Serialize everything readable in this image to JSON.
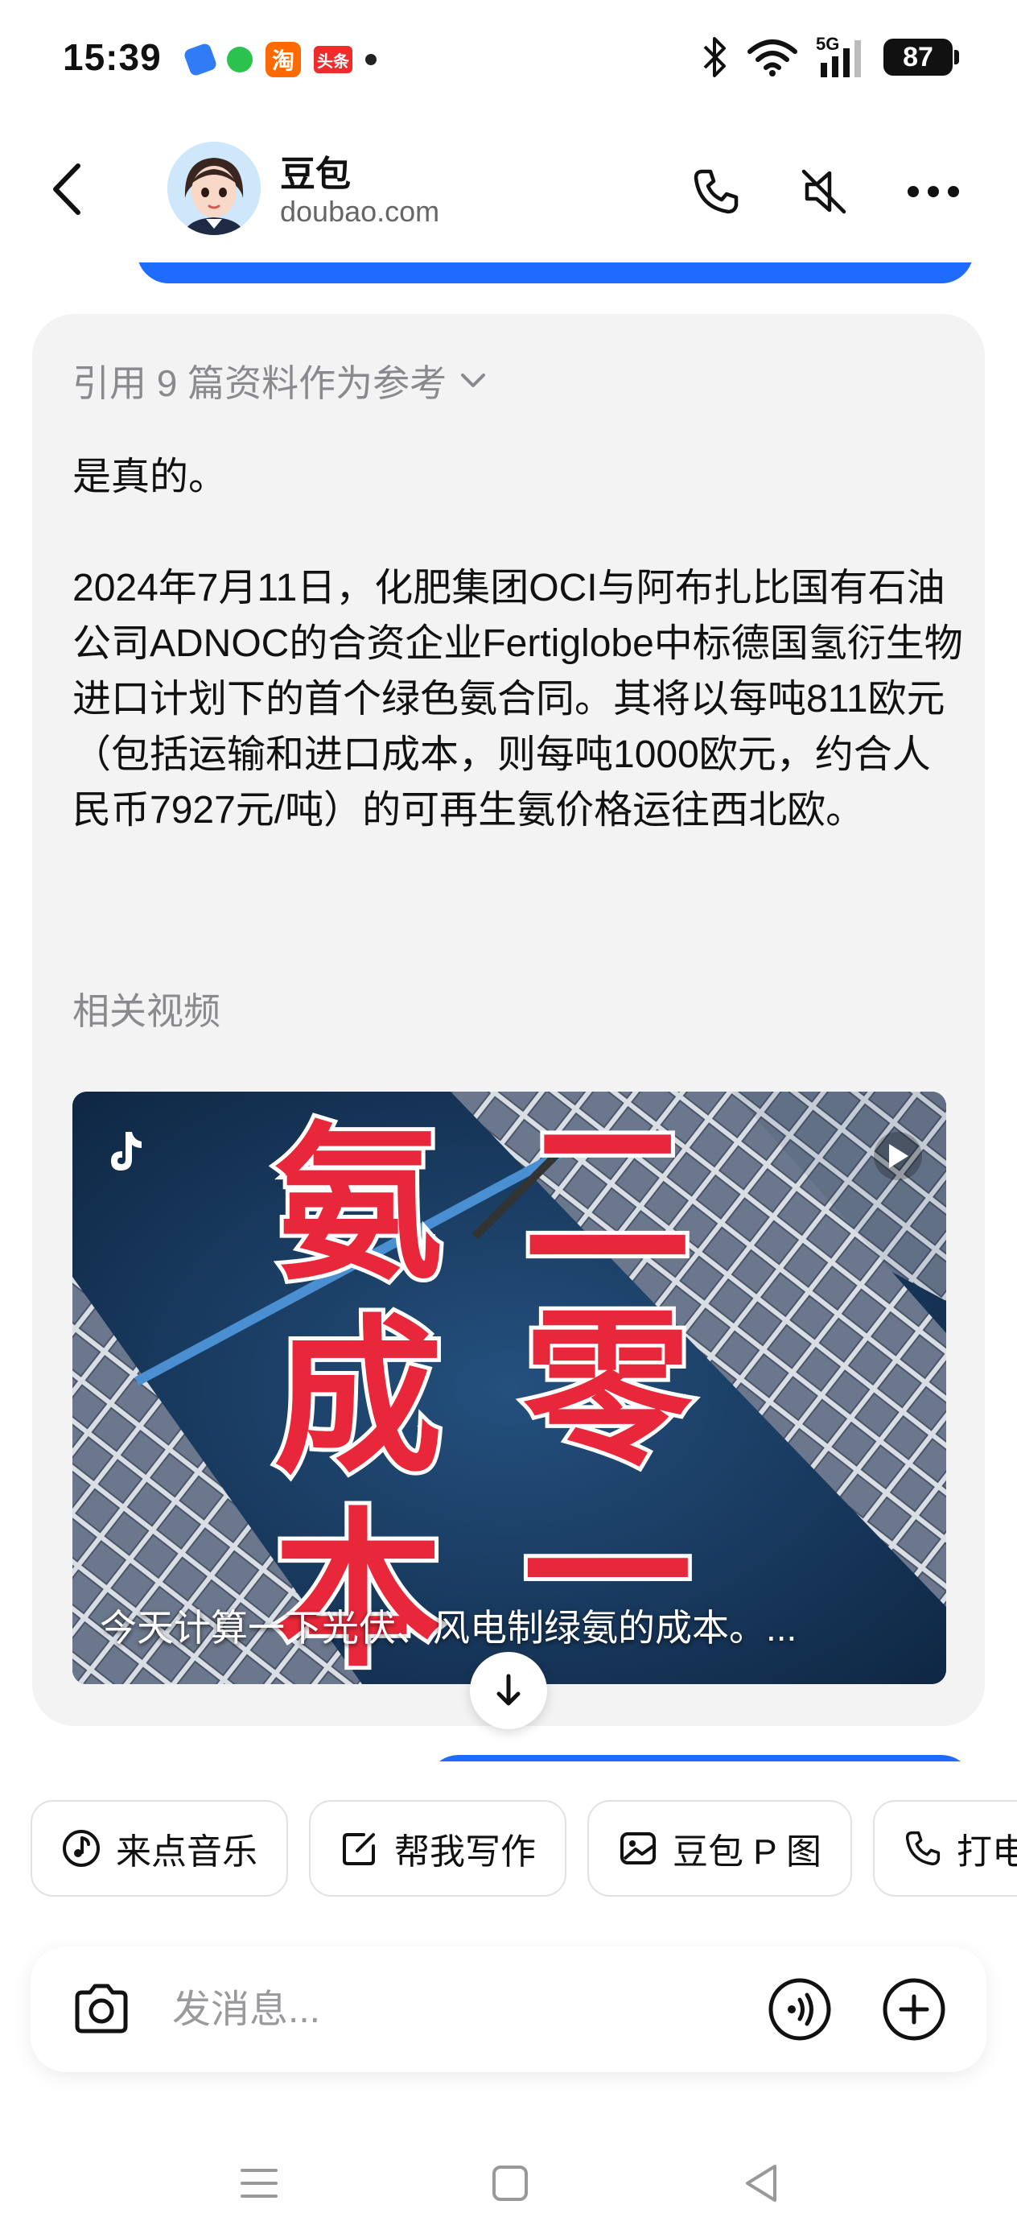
{
  "status_bar": {
    "time": "15:39",
    "notif_orange": "淘",
    "notif_red": "头条",
    "network": "5G",
    "battery": "87"
  },
  "header": {
    "name": "豆包",
    "subtitle": "doubao.com"
  },
  "message": {
    "references": "引用 9 篇资料作为参考",
    "paragraphs": [
      "是真的。",
      "2024年7月11日，化肥集团OCI与阿布扎比国有石油公司ADNOC的合资企业Fertiglobe中标德国氢衍生物进口计划下的首个绿色氨合同。其将以每吨811欧元（包括运输和进口成本，则每吨1000欧元，约合人民币7927元/吨）的可再生氨价格运往西北欧。"
    ],
    "related_label": "相关视频",
    "video": {
      "overlay_text": [
        "氨",
        "成",
        "本",
        "二",
        "零",
        "一"
      ],
      "caption": "今天计算一下光伏、风电制绿氨的成本。..."
    }
  },
  "quick_actions": [
    {
      "label": "来点音乐",
      "icon": "music-icon"
    },
    {
      "label": "帮我写作",
      "icon": "edit-icon"
    },
    {
      "label": "豆包 P 图",
      "icon": "image-edit-icon"
    },
    {
      "label": "打电",
      "icon": "phone-icon"
    }
  ],
  "input": {
    "placeholder": "发消息..."
  },
  "colors": {
    "accent": "#1f6bff",
    "card_bg": "#f3f3f4",
    "muted_text": "#8a8a8e",
    "video_text_red": "#e8283a"
  }
}
